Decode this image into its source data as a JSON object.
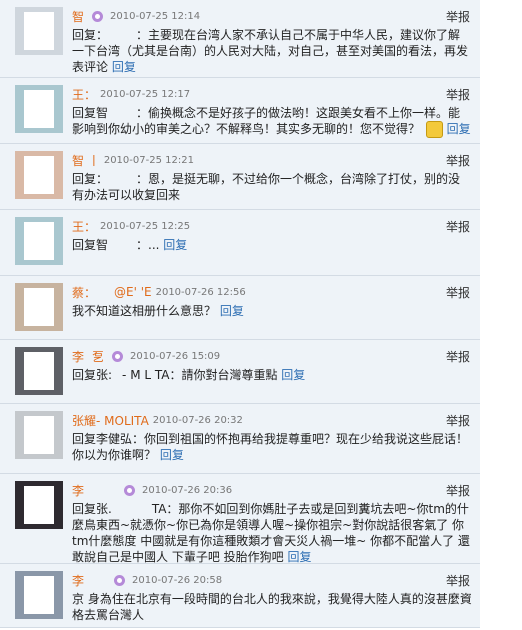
{
  "report_label": "举报",
  "reply_label": "回复",
  "comments": [
    {
      "name": "智",
      "time": "2010-07-25 12:14",
      "prefix": "回复：",
      "text": "：主要现在台湾人家不承认自己不属于中华人民，建议你了解一下台湾（尤其是台南）的人民对大陆，对自己，甚至对美国的看法，再发表评论"
    },
    {
      "name": "王：",
      "time": "2010-07-25 12:17",
      "prefix": "回复智",
      "text": "：偷换概念不是好孩子的做法哟！这跟美女看不上你一样。能影响到你幼小的审美之心？不解释鸟！其实多无聊的！您不觉得？"
    },
    {
      "name": "智 丨",
      "time": "2010-07-25 12:21",
      "prefix": "回复：",
      "text": "：恩，是挺无聊，不过给你一个概念，台湾除了打仗，别的没有办法可以收复回来"
    },
    {
      "name": "王：",
      "time": "2010-07-25 12:25",
      "prefix": "回复智",
      "text": "：..."
    },
    {
      "name": "蔡：",
      "name2": "@E' 'E",
      "time": "2010-07-26 12:56",
      "prefix": "",
      "text": "我不知道这相册什么意思？"
    },
    {
      "name": "李",
      "name2": "乭",
      "time": "2010-07-26 15:09",
      "prefix": "回复张:",
      "text": "- M   L TA：請你對台灣尊重點"
    },
    {
      "name": "张耀- MOLITA",
      "time": "2010-07-26 20:32",
      "prefix": "回复李健弘：",
      "text": "你回到祖国的怀抱再给我提尊重吧？现在少给我说这些屁话！你以为你谁啊？"
    },
    {
      "name": "李",
      "time": "2010-07-26 20:36",
      "prefix": "回复张.",
      "text": "TA：那你不如回到你媽肚子去或是回到糞坑去吧~你tm的什麼鳥東西~就憑你~你已為你是領導人喔~操你祖宗~對你說話很客氣了 你tm什麼態度 中國就是有你這種敗類才會天災人禍一堆~ 你都不配當人了 還敢說自己是中國人 下輩子吧 投胎作狗吧"
    },
    {
      "name": "李",
      "time": "2010-07-26 20:58",
      "prefix": "",
      "text": "京 身為住在北京有一段時間的台北人的我來說，我覺得大陸人真的沒甚麼資格去罵台灣人"
    }
  ]
}
